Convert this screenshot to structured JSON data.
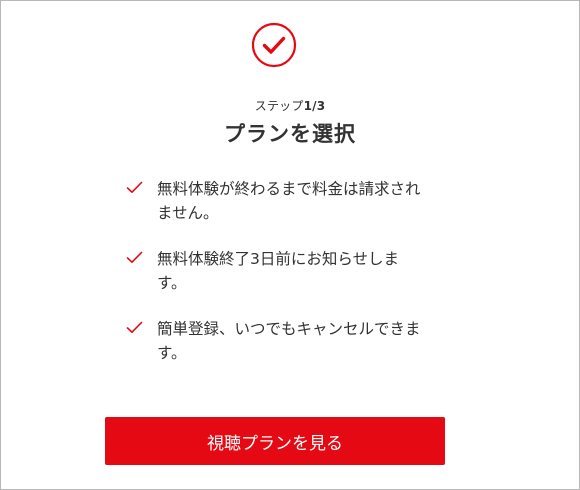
{
  "colors": {
    "accent": "#e50914",
    "text": "#333333",
    "border": "#b8b8b8"
  },
  "header": {
    "icon": "check-circle-icon",
    "step_prefix": "ステップ",
    "step_count": "1/3",
    "title": "プランを選択"
  },
  "benefits": {
    "items": [
      {
        "icon": "checkmark-icon",
        "text": "無料体験が終わるまで料金は請求されません。"
      },
      {
        "icon": "checkmark-icon",
        "text": "無料体験終了3日前にお知らせします。"
      },
      {
        "icon": "checkmark-icon",
        "text": "簡単登録、いつでもキャンセルできます。"
      }
    ]
  },
  "cta": {
    "label": "視聴プランを見る"
  }
}
